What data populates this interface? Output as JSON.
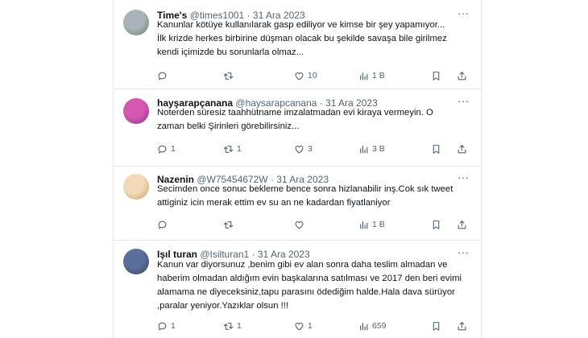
{
  "tweets": [
    {
      "name": "Time's",
      "handle": "@times1001",
      "separator": "·",
      "date": "31 Ara 2023",
      "more_icon": "more-icon",
      "lines": [
        "Kanunlar kötüye kullanılarak gasp ediliyor ve kimse bir şey yapamıyor...",
        "İlk krizde herkes birbirine düşman olacak bu şekilde savaşa bile girilmez",
        "kendi içimizde bu sorunlarla olmaz..."
      ],
      "stats": {
        "replies": "",
        "retweets": "",
        "likes": "10",
        "views": "1 B"
      },
      "avatar_colors": [
        "#aab4b8",
        "#6f7a60"
      ]
    },
    {
      "name": "hayşarapçanana",
      "handle": "@haysarapcanana",
      "separator": "·",
      "date": "31 Ara 2023",
      "more_icon": "more-icon",
      "lines": [
        "Noterden süresiz taahhütname imzalatmadan evi kiraya vermeyin. O",
        "zaman belki Şirinleri görebilirsiniz..."
      ],
      "stats": {
        "replies": "1",
        "retweets": "1",
        "likes": "3",
        "views": "3 B"
      },
      "avatar_colors": [
        "#d657b0",
        "#7a3a8c"
      ]
    },
    {
      "name": "Nazenin",
      "handle": "@W75454672W",
      "separator": "·",
      "date": "31 Ara 2023",
      "more_icon": "more-icon",
      "lines": [
        "Secimden once sonuc bekleme bence sonra hizlanabilir inş.Cok sık tweet",
        "attiginiz icin merak ettim ev su an ne kadardan fiyatlaniyor"
      ],
      "stats": {
        "replies": "",
        "retweets": "",
        "likes": "",
        "views": "1 B"
      },
      "avatar_colors": [
        "#f2d9b8",
        "#c9a06a"
      ]
    },
    {
      "name": "Işıl turan",
      "handle": "@Isilturan1",
      "separator": "·",
      "date": "31 Ara 2023",
      "more_icon": "more-icon",
      "lines": [
        "Kanun var diyorsunuz ,benim gibi ev alan sonra daha teslim almadan ve",
        "haberim olmadan aldığım evin başkalarına satılması ve 2017 den beri evimi",
        "alamama ne diyeceksiniz,tapu parasını ödediğim halde.Hala dava sürüyor",
        ",paralar yeniyor.Yazıklar olsun !!!"
      ],
      "stats": {
        "replies": "1",
        "retweets": "1",
        "likes": "1",
        "views": "659"
      },
      "avatar_colors": [
        "#5a6f9a",
        "#3d3f56"
      ]
    }
  ],
  "icons": {
    "reply": "reply-icon",
    "retweet": "retweet-icon",
    "like": "heart-icon",
    "views": "views-icon",
    "bookmark": "bookmark-icon",
    "share": "share-icon"
  },
  "colors": {
    "text": "#0f1419",
    "muted": "#536471",
    "border": "#e6e9eb"
  }
}
